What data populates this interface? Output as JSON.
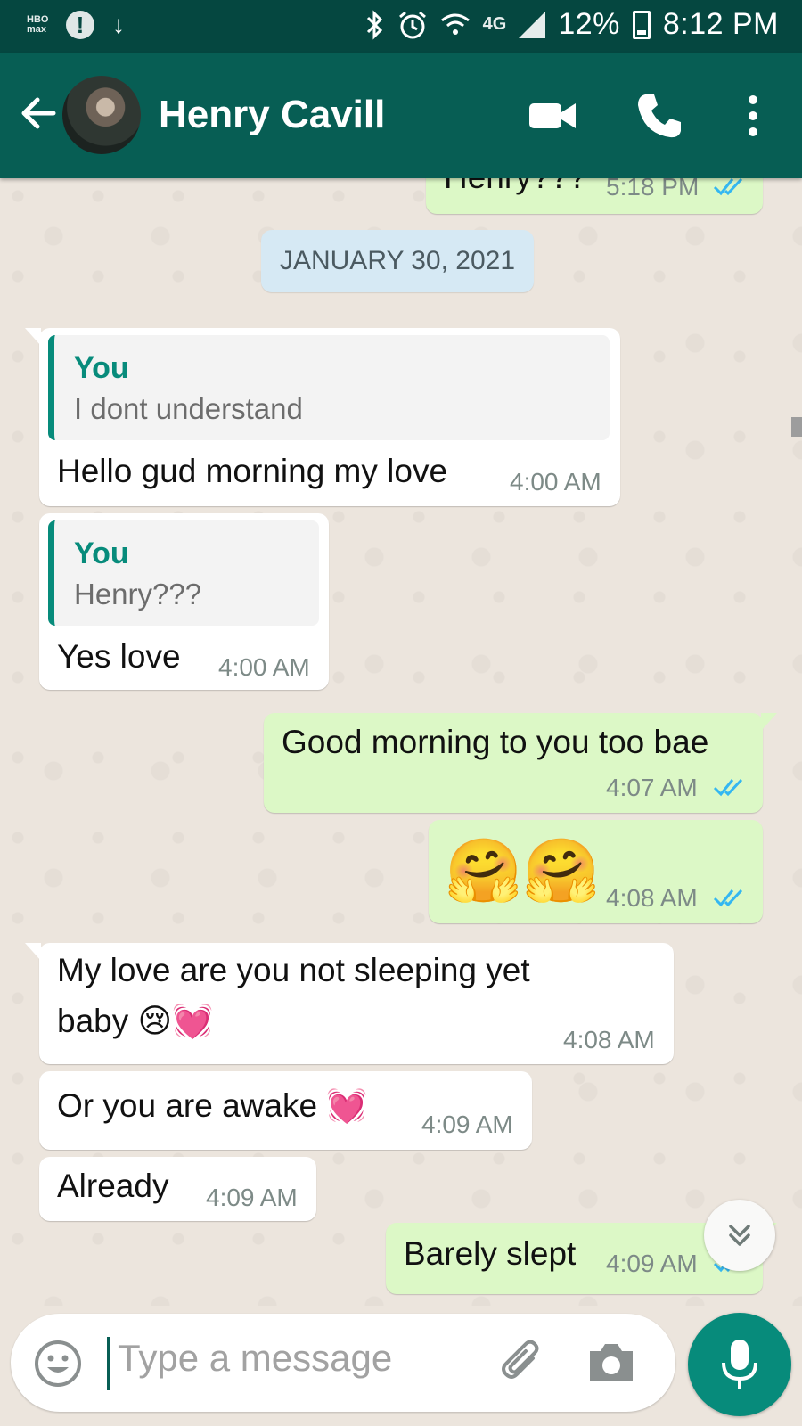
{
  "status_bar": {
    "left_badge": "HBO max",
    "alert_glyph": "!",
    "download_glyph": "↓",
    "network": "4G",
    "battery_percent": "12%",
    "time": "8:12 PM",
    "icons": [
      "bluetooth-icon",
      "alarm-icon",
      "wifi-icon",
      "signal-icon",
      "battery-icon"
    ]
  },
  "header": {
    "contact_name": "Henry Cavill",
    "icons": [
      "back-arrow-icon",
      "video-call-icon",
      "phone-icon",
      "more-options-icon"
    ],
    "bar_color": "#075e54"
  },
  "chat": {
    "partial_message": {
      "text": "Henry???",
      "time": "5:18 PM"
    },
    "date_chip": "JANUARY 30, 2021",
    "messages": [
      {
        "side": "in",
        "quote_author": "You",
        "quote_text": "I dont understand",
        "text": "Hello gud morning my love",
        "time": "4:00 AM"
      },
      {
        "side": "in",
        "quote_author": "You",
        "quote_text": "Henry???",
        "text": "Yes love",
        "time": "4:00 AM"
      },
      {
        "side": "out",
        "text": "Good morning to you too bae",
        "time": "4:07 AM"
      },
      {
        "side": "out",
        "text": "🤗🤗",
        "time": "4:08 AM"
      },
      {
        "side": "in",
        "text_line1": "My love are  you not sleeping yet",
        "text_line2": "baby 😢💓",
        "time": "4:08 AM"
      },
      {
        "side": "in",
        "text": "Or you are awake 💓",
        "time": "4:09 AM"
      },
      {
        "side": "in",
        "text": "Already",
        "time": "4:09 AM"
      },
      {
        "side": "out",
        "text": "Barely slept",
        "time": "4:09 AM"
      }
    ],
    "incoming_color": "#ffffff",
    "outgoing_color": "#dcf8c6",
    "read_tick_color": "#34b7f1"
  },
  "composer": {
    "placeholder": "Type a message",
    "icons": [
      "emoji-icon",
      "attach-icon",
      "camera-icon",
      "mic-icon",
      "scroll-down-icon"
    ],
    "accent_color": "#078b7b"
  }
}
